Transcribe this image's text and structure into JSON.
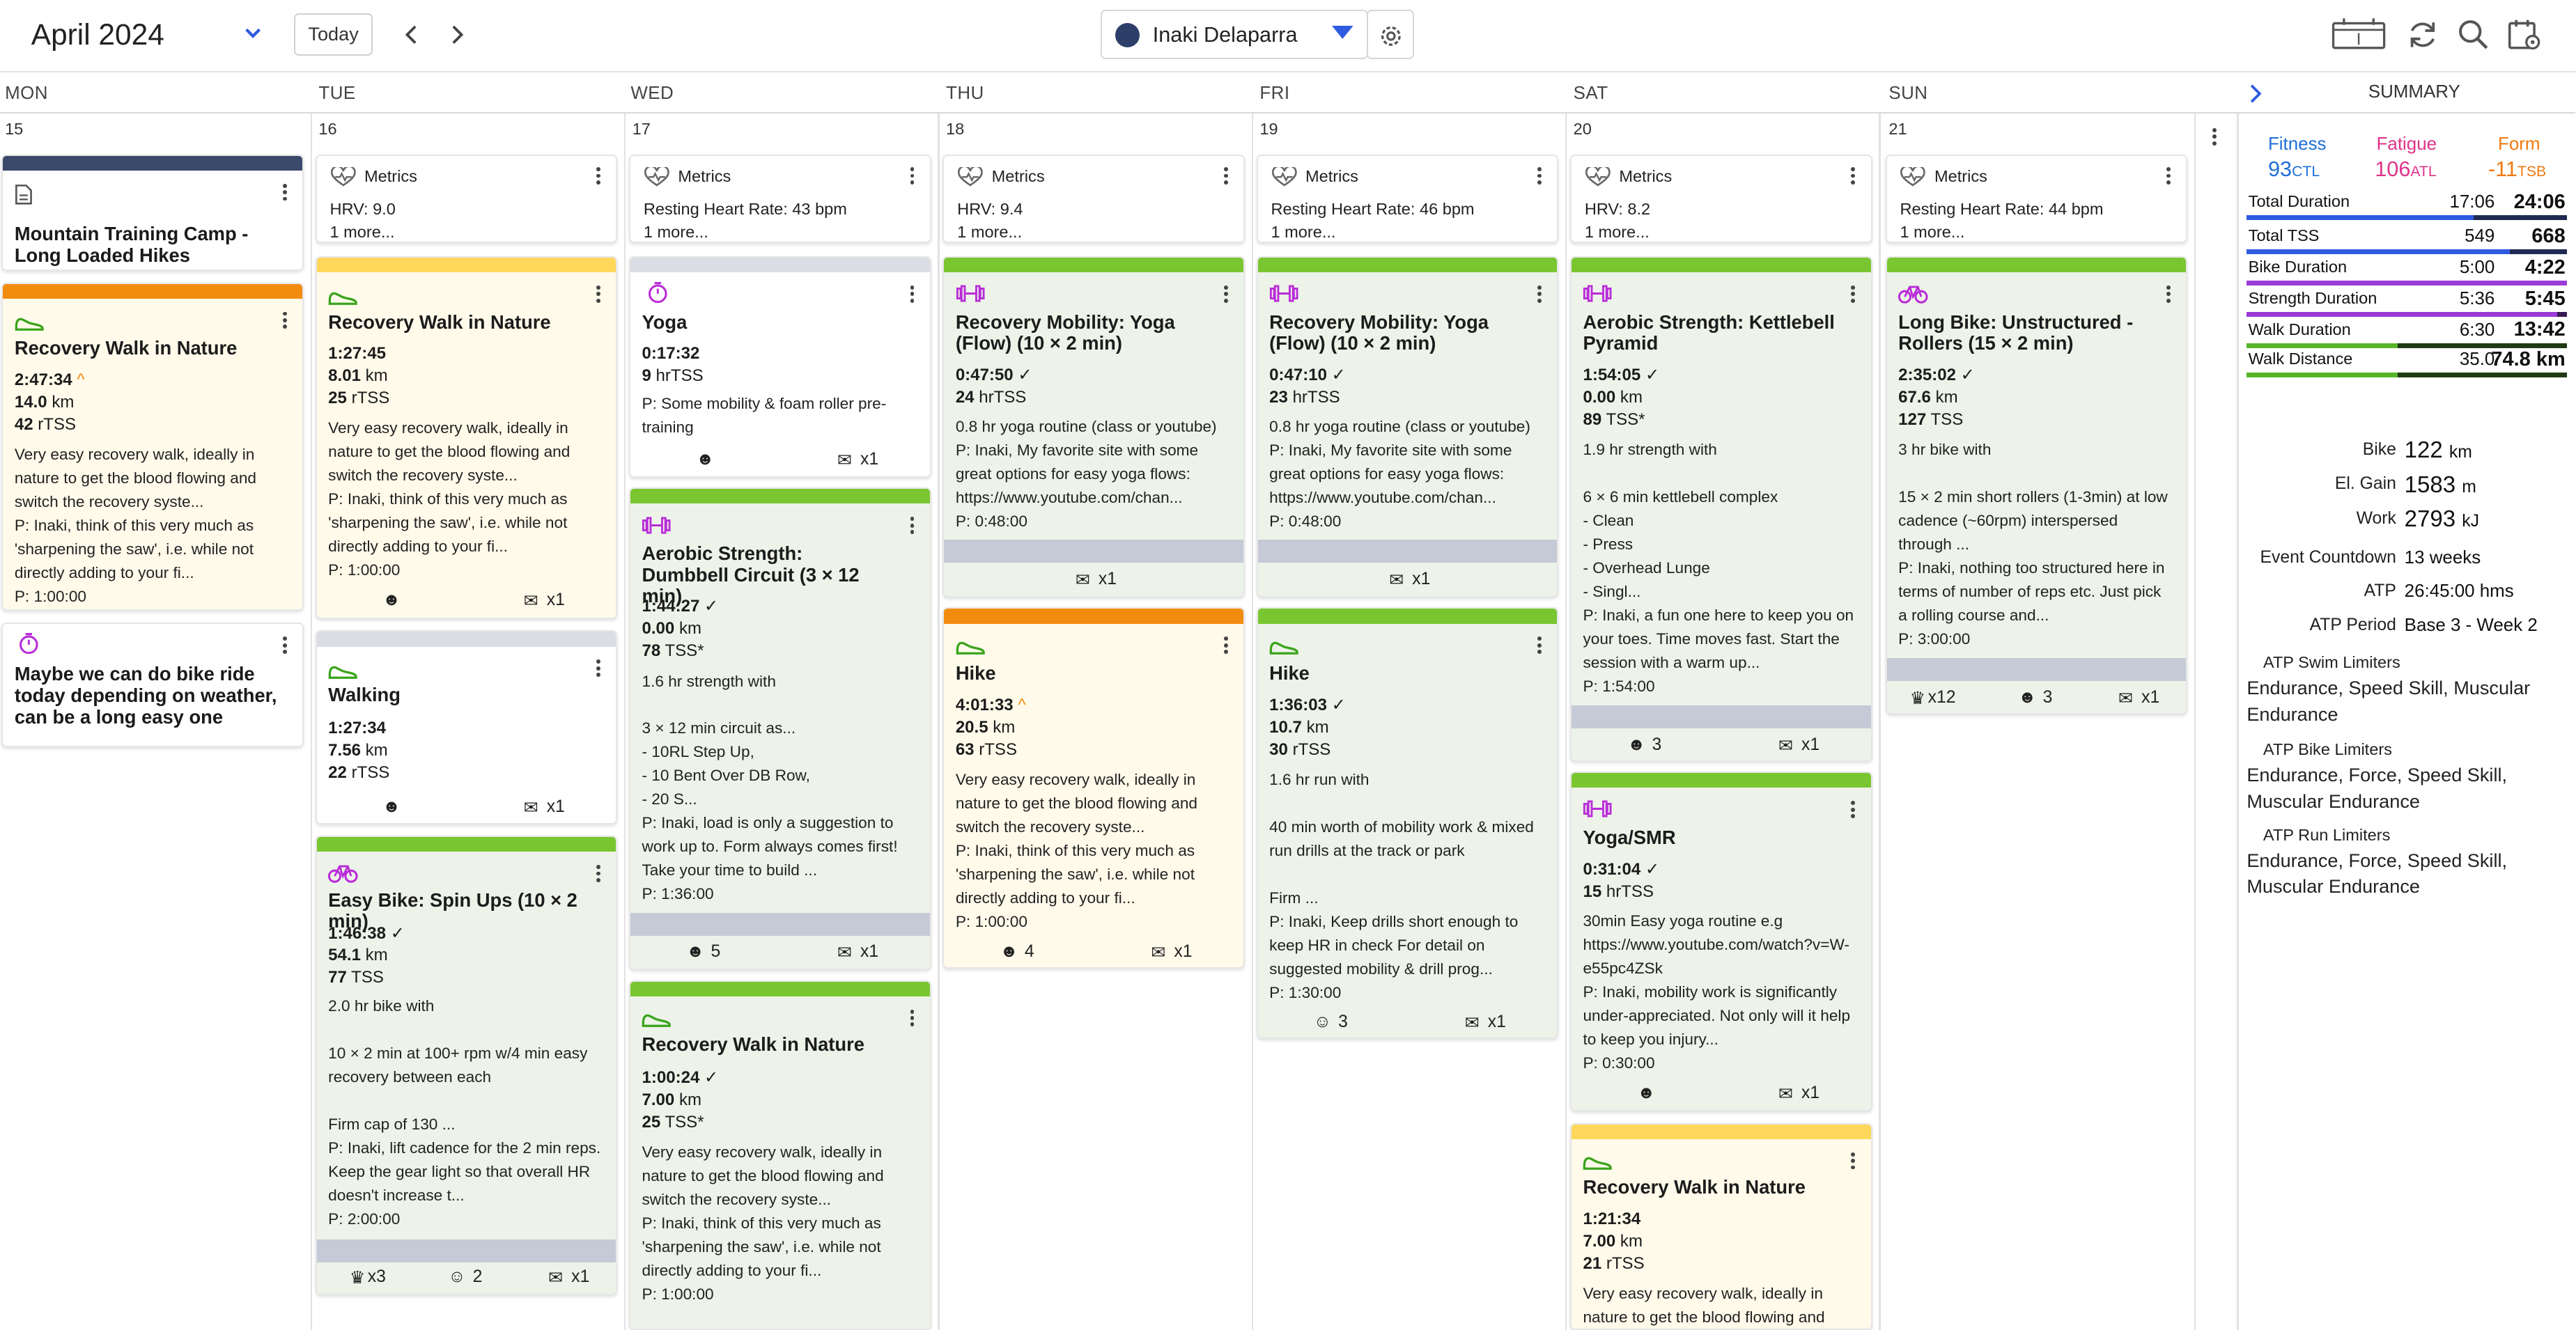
{
  "header": {
    "month": "April 2024",
    "today_label": "Today",
    "athlete_name": "Inaki Delaparra",
    "accent": "#2f5be0"
  },
  "days": [
    {
      "name": "MON",
      "num": "15"
    },
    {
      "name": "TUE",
      "num": "16"
    },
    {
      "name": "WED",
      "num": "17"
    },
    {
      "name": "THU",
      "num": "18"
    },
    {
      "name": "FRI",
      "num": "19"
    },
    {
      "name": "SAT",
      "num": "20"
    },
    {
      "name": "SUN",
      "num": "21"
    }
  ],
  "metrics": [
    {},
    {
      "label": "Metrics",
      "line1": "HRV: 9.0",
      "line2": "1 more..."
    },
    {
      "label": "Metrics",
      "line1": "Resting Heart Rate: 43 bpm",
      "line2": "1 more..."
    },
    {
      "label": "Metrics",
      "line1": "HRV: 9.4",
      "line2": "1 more..."
    },
    {
      "label": "Metrics",
      "line1": "Resting Heart Rate: 46 bpm",
      "line2": "1 more..."
    },
    {
      "label": "Metrics",
      "line1": "HRV: 8.2",
      "line2": "1 more..."
    },
    {
      "label": "Metrics",
      "line1": "Resting Heart Rate: 44 bpm",
      "line2": "1 more..."
    }
  ],
  "notes": {
    "camp": "Mountain Training Camp - Long Loaded Hikes",
    "maybe": "Maybe we can do bike ride today depending on weather, can be a long easy one"
  },
  "workouts": {
    "mon_walk": {
      "title": "Recovery Walk in Nature",
      "dur": "2:47:34",
      "dist": "14.0",
      "tss": "42",
      "tss_unit": "rTSS",
      "desc": "Very easy recovery walk, ideally in nature to get the blood flowing and switch the recovery syste...\nP: Inaki, think of this very much as 'sharpening the saw', i.e. while not directly adding to your fi...\nP: 1:00:00"
    },
    "tue_walk": {
      "title": "Recovery Walk in Nature",
      "dur": "1:27:45",
      "dist": "8.01",
      "tss": "25",
      "tss_unit": "rTSS",
      "desc": "Very easy recovery walk, ideally in nature to get the blood flowing and switch the recovery syste...\nP: Inaki, think of this very much as 'sharpening the saw', i.e. while not directly adding to your fi...\nP: 1:00:00",
      "comments": "x1"
    },
    "tue_walking": {
      "title": "Walking",
      "dur": "1:27:34",
      "dist": "7.56",
      "tss": "22",
      "tss_unit": "rTSS",
      "comments": "x1"
    },
    "tue_bike": {
      "title": "Easy Bike: Spin Ups (10 × 2 min)",
      "dur": "1:46:38",
      "dist": "54.1",
      "tss": "77",
      "tss_unit": "TSS",
      "desc": "2.0 hr bike with\n\n10 × 2 min at 100+ rpm w/4 min easy recovery between each\n\nFirm cap of 130 ...\nP: Inaki, lift cadence for the 2 min reps. Keep the gear light so that overall HR doesn't increase t...\nP: 2:00:00",
      "medals": "x3",
      "feel": "2",
      "comments": "x1"
    },
    "wed_yoga": {
      "title": "Yoga",
      "dur": "0:17:32",
      "tss": "9",
      "tss_unit": "hrTSS",
      "desc": "P: Some mobility & foam roller pre-training",
      "comments": "x1"
    },
    "wed_db": {
      "title": "Aerobic Strength: Dumbbell Circuit (3 × 12 min)",
      "dur": "1:44:27",
      "dist": "0.00",
      "tss": "78",
      "tss_unit": "TSS*",
      "desc": "1.6 hr strength with\n\n3 × 12 min circuit as...\n- 10RL Step Up,\n- 10 Bent Over DB Row,\n- 20 S...\nP: Inaki, load is only a suggestion to work up to. Form always comes first! Take your time to build ...\nP: 1:36:00",
      "feel": "5",
      "comments": "x1"
    },
    "wed_walk": {
      "title": "Recovery Walk in Nature",
      "dur": "1:00:24",
      "dist": "7.00",
      "tss": "25",
      "tss_unit": "TSS*",
      "desc": "Very easy recovery walk, ideally in nature to get the blood flowing and switch the recovery syste...\nP: Inaki, think of this very much as 'sharpening the saw', i.e. while not directly adding to your fi...\nP: 1:00:00"
    },
    "thu_yoga": {
      "title": "Recovery Mobility: Yoga (Flow) (10 × 2 min)",
      "dur": "0:47:50",
      "tss": "24",
      "tss_unit": "hrTSS",
      "desc": "0.8 hr yoga routine (class or youtube)\nP: Inaki, My favorite site with some great options for easy yoga flows: https://www.youtube.com/chan...\nP: 0:48:00",
      "comments": "x1"
    },
    "thu_hike": {
      "title": "Hike",
      "dur": "4:01:33",
      "dist": "20.5",
      "tss": "63",
      "tss_unit": "rTSS",
      "desc": "Very easy recovery walk, ideally in nature to get the blood flowing and switch the recovery syste...\nP: Inaki, think of this very much as 'sharpening the saw', i.e. while not directly adding to your fi...\nP: 1:00:00",
      "feel": "4",
      "comments": "x1"
    },
    "fri_yoga": {
      "title": "Recovery Mobility: Yoga (Flow) (10 × 2 min)",
      "dur": "0:47:10",
      "tss": "23",
      "tss_unit": "hrTSS",
      "desc": "0.8 hr yoga routine (class or youtube)\nP: Inaki, My favorite site with some great options for easy yoga flows: https://www.youtube.com/chan...\nP: 0:48:00",
      "comments": "x1"
    },
    "fri_hike": {
      "title": "Hike",
      "dur": "1:36:03",
      "dist": "10.7",
      "tss": "30",
      "tss_unit": "rTSS",
      "desc": "1.6 hr run with\n\n40 min worth of mobility work & mixed run drills at the track or park\n\nFirm ...\nP: Inaki, Keep drills short enough to keep HR in check For detail on suggested mobility & drill prog...\nP: 1:30:00",
      "feel": "3",
      "comments": "x1"
    },
    "sat_kb": {
      "title": "Aerobic Strength: Kettlebell Pyramid",
      "dur": "1:54:05",
      "dist": "0.00",
      "tss": "89",
      "tss_unit": "TSS*",
      "desc": "1.9 hr strength with\n\n6 × 6 min kettlebell complex\n- Clean\n- Press\n- Overhead Lunge\n- Singl...\nP: Inaki, a fun one here to keep you on your toes. Time moves fast. Start the session with a warm up...\nP: 1:54:00",
      "feel": "3",
      "comments": "x1"
    },
    "sat_yoga": {
      "title": "Yoga/SMR",
      "dur": "0:31:04",
      "tss": "15",
      "tss_unit": "hrTSS",
      "desc": "30min Easy yoga routine e.g https://www.youtube.com/watch?v=W-e55pc4ZSk\nP: Inaki, mobility work is significantly under-appreciated. Not only will it help to keep you injury...\nP: 0:30:00",
      "comments": "x1"
    },
    "sat_walk": {
      "title": "Recovery Walk in Nature",
      "dur": "1:21:34",
      "dist": "7.00",
      "tss": "21",
      "tss_unit": "rTSS",
      "desc": "Very easy recovery walk, ideally in nature to get the blood flowing and"
    },
    "sun_bike": {
      "title": "Long Bike: Unstructured - Rollers (15 × 2 min)",
      "dur": "2:35:02",
      "dist": "67.6",
      "tss": "127",
      "tss_unit": "TSS",
      "desc": "3 hr bike with\n\n15 × 2 min short rollers (1-3min) at low cadence (~60rpm) interspersed through ...\nP: Inaki, nothing too structured here in terms of number of reps etc. Just pick a rolling course and...\nP: 3:00:00",
      "medals": "x12",
      "feel": "3",
      "comments": "x1"
    }
  },
  "units": {
    "km": "km"
  },
  "summary": {
    "title": "SUMMARY",
    "fitness": {
      "label": "Fitness",
      "value": "93",
      "unit": "CTL",
      "color": "#1f6fd6"
    },
    "fatigue": {
      "label": "Fatigue",
      "value": "106",
      "unit": "ATL",
      "color": "#e0338a"
    },
    "form": {
      "label": "Form",
      "value": "-11",
      "unit": "TSB",
      "color": "#f07a10"
    },
    "rows": [
      {
        "label": "Total Duration",
        "v1": "17:06",
        "v2": "24:06",
        "fraction": 0.71,
        "color": "#2f5be0",
        "track": "#1f2a52"
      },
      {
        "label": "Total TSS",
        "v1": "549",
        "v2": "668",
        "fraction": 0.82,
        "color": "#2f5be0",
        "track": "#1f2a52"
      },
      {
        "label": "Bike Duration",
        "v1": "5:00",
        "v2": "4:22",
        "fraction": 1.0,
        "color": "#9b3bd6",
        "track": "#3a1a55"
      },
      {
        "label": "Strength Duration",
        "v1": "5:36",
        "v2": "5:45",
        "fraction": 0.97,
        "color": "#9b3bd6",
        "track": "#3a1a55"
      },
      {
        "label": "Walk Duration",
        "v1": "6:30",
        "v2": "13:42",
        "fraction": 0.47,
        "color": "#58b52a",
        "track": "#1f3b14"
      },
      {
        "label": "Walk Distance",
        "v1": "35.0",
        "v2": "74.8 km",
        "fraction": 0.47,
        "color": "#58b52a",
        "track": "#1f3b14"
      }
    ],
    "kv": [
      {
        "k": "Bike",
        "v": "122",
        "u": "km"
      },
      {
        "k": "El. Gain",
        "v": "1583",
        "u": "m"
      },
      {
        "k": "Work",
        "v": "2793",
        "u": "kJ"
      },
      {
        "k": "Event Countdown",
        "v": "13 weeks",
        "u": ""
      },
      {
        "k": "ATP",
        "v": "26:45:00 hms",
        "u": ""
      },
      {
        "k": "ATP Period",
        "v": "Base 3 - Week 2",
        "u": ""
      }
    ],
    "limiters": [
      {
        "k": "ATP Swim Limiters",
        "v": "Endurance, Speed Skill, Muscular Endurance"
      },
      {
        "k": "ATP Bike Limiters",
        "v": "Endurance, Force, Speed Skill, Muscular Endurance"
      },
      {
        "k": "ATP Run Limiters",
        "v": "Endurance, Force, Speed Skill, Muscular Endurance"
      }
    ]
  }
}
